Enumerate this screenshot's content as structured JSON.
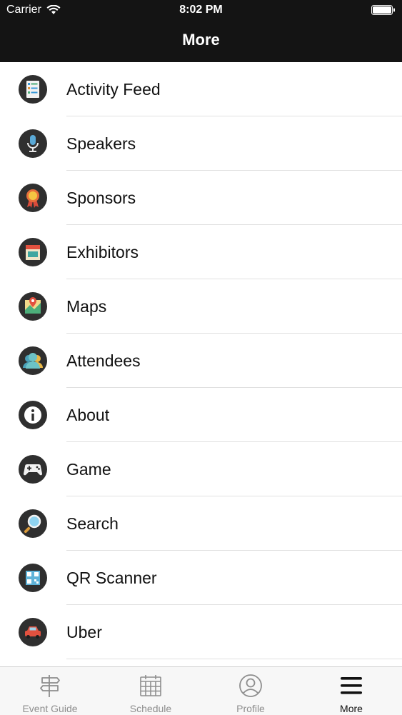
{
  "status_bar": {
    "carrier": "Carrier",
    "time": "8:02 PM"
  },
  "nav": {
    "title": "More"
  },
  "menu": [
    {
      "label": "Activity Feed",
      "icon": "activity-feed-icon"
    },
    {
      "label": "Speakers",
      "icon": "microphone-icon"
    },
    {
      "label": "Sponsors",
      "icon": "ribbon-badge-icon"
    },
    {
      "label": "Exhibitors",
      "icon": "booth-icon"
    },
    {
      "label": "Maps",
      "icon": "map-pin-icon"
    },
    {
      "label": "Attendees",
      "icon": "people-icon"
    },
    {
      "label": "About",
      "icon": "info-icon"
    },
    {
      "label": "Game",
      "icon": "gamepad-icon"
    },
    {
      "label": "Search",
      "icon": "magnifier-icon"
    },
    {
      "label": "QR Scanner",
      "icon": "qr-code-icon"
    },
    {
      "label": "Uber",
      "icon": "car-icon"
    }
  ],
  "tabs": [
    {
      "label": "Event Guide",
      "icon": "signpost-icon"
    },
    {
      "label": "Schedule",
      "icon": "calendar-icon"
    },
    {
      "label": "Profile",
      "icon": "user-circle-icon"
    },
    {
      "label": "More",
      "icon": "menu-icon",
      "active": true
    }
  ],
  "colors": {
    "nav_bg": "#141414",
    "icon_circle": "#2f2f2f",
    "tab_active": "#111111",
    "tab_inactive": "#8e8e8e"
  }
}
